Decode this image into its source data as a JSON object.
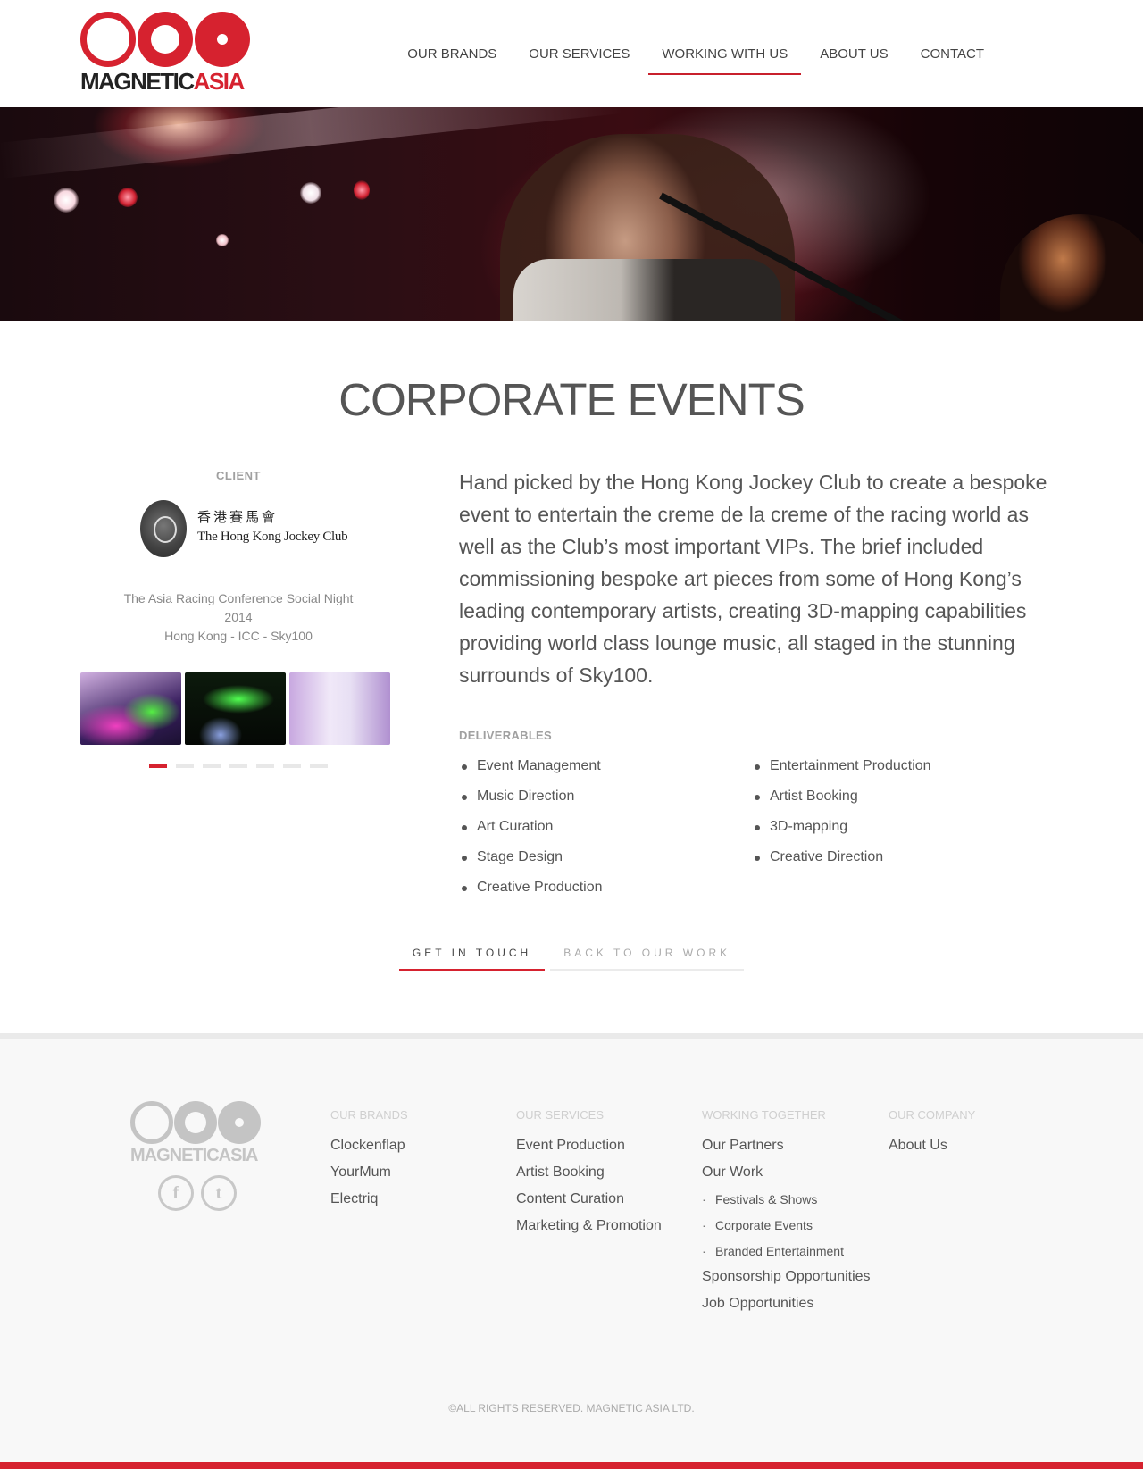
{
  "brand": {
    "name_dark": "MAGNETIC",
    "name_red": "ASIA",
    "accent": "#d6222f"
  },
  "nav": {
    "items": [
      {
        "label": "OUR BRANDS"
      },
      {
        "label": "OUR SERVICES"
      },
      {
        "label": "WORKING WITH US"
      },
      {
        "label": "ABOUT US"
      },
      {
        "label": "CONTACT"
      }
    ],
    "active": "WORKING WITH US"
  },
  "page": {
    "title": "CORPORATE EVENTS"
  },
  "client": {
    "label": "CLIENT",
    "logo_zh": "香港賽馬會",
    "logo_en": "The Hong Kong Jockey Club",
    "event_name": "The Asia Racing Conference Social Night",
    "year": "2014",
    "location": "Hong Kong - ICC - Sky100"
  },
  "gallery": {
    "slide_count": 7,
    "active_index": 0
  },
  "description": "Hand picked by the Hong Kong Jockey Club to create a bespoke event to entertain the creme de la creme of the racing world as well as the Club’s most important VIPs. The brief included commissioning bespoke art pieces from some of Hong Kong’s leading contemporary artists, creating 3D-mapping capabilities providing world class lounge music, all staged in the stunning surrounds of Sky100.",
  "deliverables": {
    "label": "DELIVERABLES",
    "col1": [
      "Event Management",
      "Music Direction",
      "Art Curation",
      "Stage Design",
      "Creative Production"
    ],
    "col2": [
      "Entertainment Production",
      "Artist Booking",
      "3D-mapping",
      "Creative Direction"
    ]
  },
  "actions": {
    "primary": "GET IN TOUCH",
    "secondary": "BACK TO OUR WORK"
  },
  "footer": {
    "logo_text": "MAGNETICASIA",
    "social": {
      "facebook": "f",
      "twitter": "t"
    },
    "brands": {
      "heading": "OUR BRANDS",
      "links": [
        "Clockenflap",
        "YourMum",
        "Electriq"
      ]
    },
    "services": {
      "heading": "OUR SERVICES",
      "links": [
        "Event Production",
        "Artist Booking",
        "Content Curation",
        "Marketing & Promotion"
      ]
    },
    "working": {
      "heading": "WORKING TOGETHER",
      "partners": "Our Partners",
      "work": "Our Work",
      "sub": [
        "Festivals & Shows",
        "Corporate Events",
        "Branded Entertainment"
      ],
      "sponsorship": "Sponsorship Opportunities",
      "jobs": "Job Opportunities"
    },
    "company": {
      "heading": "OUR COMPANY",
      "links": [
        "About Us"
      ]
    },
    "copyright": "©ALL RIGHTS RESERVED. MAGNETIC ASIA LTD."
  }
}
